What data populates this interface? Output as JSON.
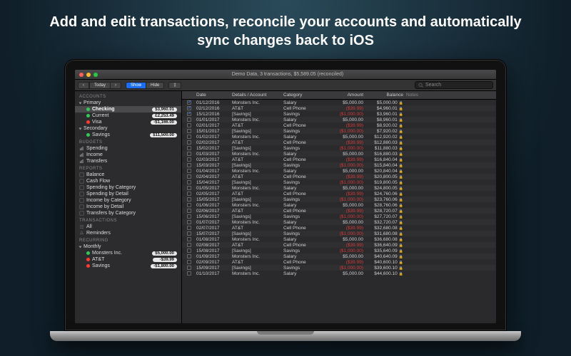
{
  "headline": "Add and edit transactions, reconcile your accounts and automatically sync changes back to iOS",
  "window_title": "Demo Data, 3 transactions, $5,589.05 (reconciled)",
  "toolbar": {
    "nav_prev": "‹",
    "today": "Today",
    "nav_next": "›",
    "show": "Show",
    "hide": "Hide",
    "filter": "‡",
    "search_placeholder": "Search"
  },
  "columns": {
    "chk": "",
    "date": "Date",
    "details": "Details / Account",
    "category": "Category",
    "amount": "Amount",
    "balance": "Balance",
    "notes": "Notes"
  },
  "sidebar": {
    "accounts_h": "ACCOUNTS",
    "primary": "Primary",
    "checking": {
      "label": "Checking",
      "amt": "$3,960.01"
    },
    "current": {
      "label": "Current",
      "amt": "£2,253.49"
    },
    "visa": {
      "label": "Visa",
      "amt": "-$1,166.00"
    },
    "secondary": "Secondary",
    "savings": {
      "label": "Savings",
      "amt": "$11,500.00"
    },
    "budgets_h": "BUDGETS",
    "spending": "Spending",
    "income": "Income",
    "transfers": "Transfers",
    "reports_h": "REPORTS",
    "balance": "Balance",
    "cashflow": "Cash Flow",
    "sbc": "Spending by Category",
    "sbd": "Spending by Detail",
    "ibc": "Income by Category",
    "ibd": "Income by Detail",
    "tbc": "Transfers by Category",
    "trans_h": "TRANSACTIONS",
    "all": "All",
    "reminders": "Reminders",
    "recurring_h": "RECURRING",
    "monthly": "Monthly",
    "mon": {
      "label": "Monsters Inc.",
      "amt": "$5,000.00"
    },
    "att": {
      "label": "AT&T",
      "amt": "-$39.99"
    },
    "sav": {
      "label": "Savings",
      "amt": "-$1,800.00"
    }
  },
  "rows": [
    {
      "chk": 1,
      "date": "01/12/2016",
      "det": "Monsters Inc.",
      "cat": "Salary",
      "amt": "$5,000.00",
      "bal": "$5,000.00",
      "lock": 1
    },
    {
      "chk": 1,
      "date": "02/12/2016",
      "det": "AT&T",
      "cat": "Cell Phone",
      "amt": "($39.99)",
      "neg": 1,
      "bal": "$4,960.01",
      "lock": 1
    },
    {
      "chk": 1,
      "date": "15/12/2016",
      "det": "[Savings]",
      "cat": "Savings",
      "amt": "($1,000.00)",
      "neg": 1,
      "bal": "$3,960.01",
      "lock": 1
    },
    {
      "chk": 0,
      "date": "01/01/2017",
      "det": "Monsters Inc.",
      "cat": "Salary",
      "amt": "$5,000.00",
      "bal": "$8,960.01",
      "lock": 1
    },
    {
      "chk": 0,
      "date": "02/01/2017",
      "det": "AT&T",
      "cat": "Cell Phone",
      "amt": "($39.99)",
      "neg": 1,
      "bal": "$8,920.02",
      "lock": 1
    },
    {
      "chk": 0,
      "date": "15/01/2017",
      "det": "[Savings]",
      "cat": "Savings",
      "amt": "($1,000.00)",
      "neg": 1,
      "bal": "$7,920.02",
      "lock": 1
    },
    {
      "chk": 0,
      "date": "01/02/2017",
      "det": "Monsters Inc.",
      "cat": "Salary",
      "amt": "$5,000.00",
      "bal": "$12,920.02",
      "lock": 1
    },
    {
      "chk": 0,
      "date": "02/02/2017",
      "det": "AT&T",
      "cat": "Cell Phone",
      "amt": "($39.99)",
      "neg": 1,
      "bal": "$12,880.03",
      "lock": 1
    },
    {
      "chk": 0,
      "date": "15/02/2017",
      "det": "[Savings]",
      "cat": "Savings",
      "amt": "($1,000.00)",
      "neg": 1,
      "bal": "$11,880.03",
      "lock": 1
    },
    {
      "chk": 0,
      "date": "01/03/2017",
      "det": "Monsters Inc.",
      "cat": "Salary",
      "amt": "$5,000.00",
      "bal": "$16,880.03",
      "lock": 1
    },
    {
      "chk": 0,
      "date": "02/03/2017",
      "det": "AT&T",
      "cat": "Cell Phone",
      "amt": "($39.99)",
      "neg": 1,
      "bal": "$16,840.04",
      "lock": 1
    },
    {
      "chk": 0,
      "date": "15/03/2017",
      "det": "[Savings]",
      "cat": "Savings",
      "amt": "($1,000.00)",
      "neg": 1,
      "bal": "$15,840.04",
      "lock": 1
    },
    {
      "chk": 0,
      "date": "01/04/2017",
      "det": "Monsters Inc.",
      "cat": "Salary",
      "amt": "$5,000.00",
      "bal": "$20,840.04",
      "lock": 1
    },
    {
      "chk": 0,
      "date": "02/04/2017",
      "det": "AT&T",
      "cat": "Cell Phone",
      "amt": "($39.99)",
      "neg": 1,
      "bal": "$20,800.05",
      "lock": 1
    },
    {
      "chk": 0,
      "date": "15/04/2017",
      "det": "[Savings]",
      "cat": "Savings",
      "amt": "($1,000.00)",
      "neg": 1,
      "bal": "$19,800.05",
      "lock": 1
    },
    {
      "chk": 0,
      "date": "01/05/2017",
      "det": "Monsters Inc.",
      "cat": "Salary",
      "amt": "$5,000.00",
      "bal": "$24,800.05",
      "lock": 1
    },
    {
      "chk": 0,
      "date": "02/05/2017",
      "det": "AT&T",
      "cat": "Cell Phone",
      "amt": "($39.99)",
      "neg": 1,
      "bal": "$24,760.06",
      "lock": 1
    },
    {
      "chk": 0,
      "date": "15/05/2017",
      "det": "[Savings]",
      "cat": "Savings",
      "amt": "($1,000.00)",
      "neg": 1,
      "bal": "$23,760.06",
      "lock": 1
    },
    {
      "chk": 0,
      "date": "01/06/2017",
      "det": "Monsters Inc.",
      "cat": "Salary",
      "amt": "$5,000.00",
      "bal": "$28,760.06",
      "lock": 1
    },
    {
      "chk": 0,
      "date": "02/06/2017",
      "det": "AT&T",
      "cat": "Cell Phone",
      "amt": "($39.99)",
      "neg": 1,
      "bal": "$28,720.07",
      "lock": 1
    },
    {
      "chk": 0,
      "date": "15/06/2017",
      "det": "[Savings]",
      "cat": "Savings",
      "amt": "($1,000.00)",
      "neg": 1,
      "bal": "$27,720.07",
      "lock": 1
    },
    {
      "chk": 0,
      "date": "01/07/2017",
      "det": "Monsters Inc.",
      "cat": "Salary",
      "amt": "$5,000.00",
      "bal": "$32,720.07",
      "lock": 1
    },
    {
      "chk": 0,
      "date": "02/07/2017",
      "det": "AT&T",
      "cat": "Cell Phone",
      "amt": "($39.99)",
      "neg": 1,
      "bal": "$32,680.08",
      "lock": 1
    },
    {
      "chk": 0,
      "date": "15/07/2017",
      "det": "[Savings]",
      "cat": "Savings",
      "amt": "($1,000.00)",
      "neg": 1,
      "bal": "$31,680.08",
      "lock": 1
    },
    {
      "chk": 0,
      "date": "01/08/2017",
      "det": "Monsters Inc.",
      "cat": "Salary",
      "amt": "$5,000.00",
      "bal": "$36,680.08",
      "lock": 1
    },
    {
      "chk": 0,
      "date": "02/08/2017",
      "det": "AT&T",
      "cat": "Cell Phone",
      "amt": "($39.99)",
      "neg": 1,
      "bal": "$36,640.09",
      "lock": 1
    },
    {
      "chk": 0,
      "date": "15/08/2017",
      "det": "[Savings]",
      "cat": "Savings",
      "amt": "($1,000.00)",
      "neg": 1,
      "bal": "$35,640.09",
      "lock": 1
    },
    {
      "chk": 0,
      "date": "01/09/2017",
      "det": "Monsters Inc.",
      "cat": "Salary",
      "amt": "$5,000.00",
      "bal": "$40,640.09",
      "lock": 1
    },
    {
      "chk": 0,
      "date": "02/09/2017",
      "det": "AT&T",
      "cat": "Cell Phone",
      "amt": "($39.99)",
      "neg": 1,
      "bal": "$40,600.10",
      "lock": 1
    },
    {
      "chk": 0,
      "date": "15/09/2017",
      "det": "[Savings]",
      "cat": "Savings",
      "amt": "($1,000.00)",
      "neg": 1,
      "bal": "$39,600.10",
      "lock": 1
    },
    {
      "chk": 0,
      "date": "01/10/2017",
      "det": "Monsters Inc.",
      "cat": "Salary",
      "amt": "$5,000.00",
      "bal": "$44,600.10",
      "lock": 1
    }
  ]
}
